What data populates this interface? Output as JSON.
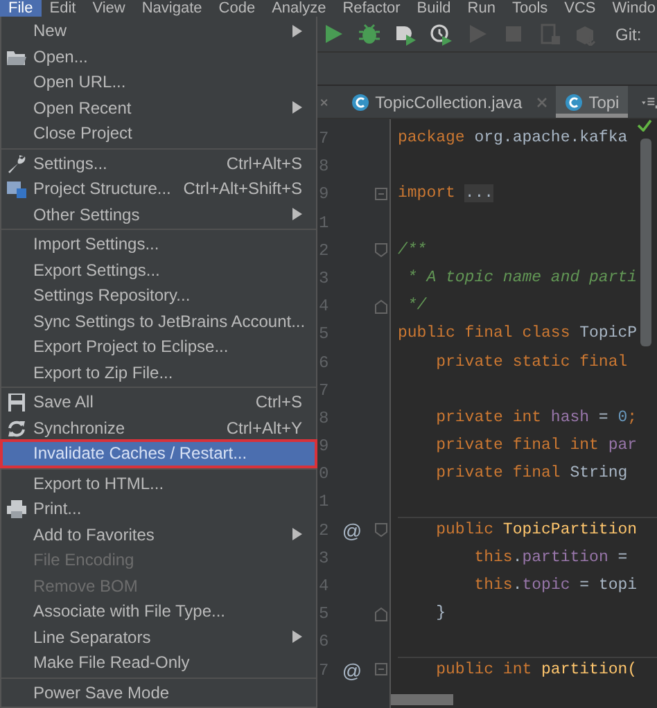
{
  "menubar": [
    {
      "label": "File",
      "selected": true
    },
    {
      "label": "Edit",
      "selected": false
    },
    {
      "label": "View",
      "selected": false
    },
    {
      "label": "Navigate",
      "selected": false
    },
    {
      "label": "Code",
      "selected": false
    },
    {
      "label": "Analyze",
      "selected": false
    },
    {
      "label": "Refactor",
      "selected": false
    },
    {
      "label": "Build",
      "selected": false
    },
    {
      "label": "Run",
      "selected": false
    },
    {
      "label": "Tools",
      "selected": false
    },
    {
      "label": "VCS",
      "selected": false
    },
    {
      "label": "Windo",
      "selected": false
    }
  ],
  "toolbar": {
    "buttons": [
      {
        "kind": "run",
        "disabled": false
      },
      {
        "kind": "debug",
        "disabled": false
      },
      {
        "kind": "coverage",
        "disabled": false
      },
      {
        "kind": "profile",
        "disabled": false
      },
      {
        "kind": "run",
        "disabled": true
      },
      {
        "kind": "stop",
        "disabled": true
      },
      {
        "kind": "device",
        "disabled": true
      },
      {
        "kind": "sdk",
        "disabled": true
      }
    ],
    "vcs_label": "Git:"
  },
  "tabs": [
    {
      "label": "TopicCollection.java",
      "selected": false
    },
    {
      "label": "Topi",
      "selected": true
    }
  ],
  "menu": {
    "groups": [
      {
        "items": [
          {
            "label": "New",
            "kind": "text",
            "submenu": true,
            "disabled": false,
            "selected": false
          },
          {
            "label": "Open...",
            "kind": "folder",
            "submenu": false,
            "disabled": false,
            "selected": false
          },
          {
            "label": "Open URL...",
            "kind": "text",
            "submenu": false,
            "disabled": false,
            "selected": false
          },
          {
            "label": "Open Recent",
            "kind": "text",
            "submenu": true,
            "disabled": false,
            "selected": false
          },
          {
            "label": "Close Project",
            "kind": "text",
            "submenu": false,
            "disabled": false,
            "selected": false
          }
        ]
      },
      {
        "items": [
          {
            "label": "Settings...",
            "shortcut": "Ctrl+Alt+S",
            "kind": "wrench",
            "submenu": false,
            "disabled": false,
            "selected": false
          },
          {
            "label": "Project Structure...",
            "shortcut": "Ctrl+Alt+Shift+S",
            "kind": "structure",
            "submenu": false,
            "disabled": false,
            "selected": false
          },
          {
            "label": "Other Settings",
            "kind": "text",
            "submenu": true,
            "disabled": false,
            "selected": false
          }
        ]
      },
      {
        "items": [
          {
            "label": "Import Settings...",
            "kind": "text",
            "submenu": false,
            "disabled": false,
            "selected": false
          },
          {
            "label": "Export Settings...",
            "kind": "text",
            "submenu": false,
            "disabled": false,
            "selected": false
          },
          {
            "label": "Settings Repository...",
            "kind": "text",
            "submenu": false,
            "disabled": false,
            "selected": false
          },
          {
            "label": "Sync Settings to JetBrains Account...",
            "kind": "text",
            "submenu": false,
            "disabled": false,
            "selected": false
          },
          {
            "label": "Export Project to Eclipse...",
            "kind": "text",
            "submenu": false,
            "disabled": false,
            "selected": false
          },
          {
            "label": "Export to Zip File...",
            "kind": "text",
            "submenu": false,
            "disabled": false,
            "selected": false
          }
        ]
      },
      {
        "items": [
          {
            "label": "Save All",
            "shortcut": "Ctrl+S",
            "kind": "save",
            "submenu": false,
            "disabled": false,
            "selected": false
          },
          {
            "label": "Synchronize",
            "shortcut": "Ctrl+Alt+Y",
            "kind": "sync",
            "submenu": false,
            "disabled": false,
            "selected": false
          },
          {
            "label": "Invalidate Caches / Restart...",
            "kind": "text",
            "submenu": false,
            "disabled": false,
            "selected": true
          }
        ]
      },
      {
        "items": [
          {
            "label": "Export to HTML...",
            "kind": "text",
            "submenu": false,
            "disabled": false,
            "selected": false
          },
          {
            "label": "Print...",
            "kind": "print",
            "submenu": false,
            "disabled": false,
            "selected": false
          },
          {
            "label": "Add to Favorites",
            "kind": "text",
            "submenu": true,
            "disabled": false,
            "selected": false
          },
          {
            "label": "File Encoding",
            "kind": "text",
            "submenu": false,
            "disabled": true,
            "selected": false
          },
          {
            "label": "Remove BOM",
            "kind": "text",
            "submenu": false,
            "disabled": true,
            "selected": false
          },
          {
            "label": "Associate with File Type...",
            "kind": "text",
            "submenu": false,
            "disabled": false,
            "selected": false
          },
          {
            "label": "Line Separators",
            "kind": "text",
            "submenu": true,
            "disabled": false,
            "selected": false
          },
          {
            "label": "Make File Read-Only",
            "kind": "text",
            "submenu": false,
            "disabled": false,
            "selected": false
          }
        ]
      },
      {
        "items": [
          {
            "label": "Power Save Mode",
            "kind": "text",
            "submenu": false,
            "disabled": false,
            "selected": false
          }
        ]
      }
    ]
  },
  "editor": {
    "lines": [
      {
        "number": "7",
        "tokens": [
          {
            "t": "package ",
            "kind": "kw"
          },
          {
            "t": "org.apache.kafka",
            "kind": "plain"
          }
        ]
      },
      {
        "number": "8"
      },
      {
        "number": "9",
        "fold": {
          "kind": "plus"
        },
        "tokens": [
          {
            "t": "import ",
            "kind": "kw"
          },
          {
            "t": "...",
            "kind": "folded"
          }
        ]
      },
      {
        "number": "1"
      },
      {
        "number": "2",
        "fold": {
          "kind": "open"
        },
        "tokens": [
          {
            "t": "/**",
            "kind": "doc"
          }
        ]
      },
      {
        "number": "3",
        "tokens": [
          {
            "t": " * A topic name and parti",
            "kind": "doc"
          }
        ]
      },
      {
        "number": "4",
        "fold": {
          "kind": "close"
        },
        "tokens": [
          {
            "t": " */",
            "kind": "doc"
          }
        ]
      },
      {
        "number": "5",
        "tokens": [
          {
            "t": "public final class ",
            "kind": "kw"
          },
          {
            "t": "TopicP",
            "kind": "plain"
          }
        ]
      },
      {
        "number": "6",
        "tokens": [
          {
            "t": "    private static final",
            "kind": "kw"
          }
        ]
      },
      {
        "number": "7"
      },
      {
        "number": "8",
        "tokens": [
          {
            "t": "    private int ",
            "kind": "kw"
          },
          {
            "t": "hash",
            "kind": "field"
          },
          {
            "t": " = ",
            "kind": "plain"
          },
          {
            "t": "0",
            "kind": "num"
          },
          {
            "t": ";",
            "kind": "kw"
          }
        ]
      },
      {
        "number": "9",
        "tokens": [
          {
            "t": "    private final int ",
            "kind": "kw"
          },
          {
            "t": "par",
            "kind": "field"
          }
        ]
      },
      {
        "number": "0",
        "tokens": [
          {
            "t": "    private final ",
            "kind": "kw"
          },
          {
            "t": "String",
            "kind": "plain"
          }
        ]
      },
      {
        "number": "1"
      },
      {
        "number": "2",
        "marker": "@",
        "fold": {
          "kind": "open"
        },
        "tokens": [
          {
            "t": "    public ",
            "kind": "kw"
          },
          {
            "t": "TopicPartition",
            "kind": "method"
          }
        ]
      },
      {
        "number": "3",
        "tokens": [
          {
            "t": "        this",
            "kind": "kw"
          },
          {
            "t": ".",
            "kind": "plain"
          },
          {
            "t": "partition",
            "kind": "field"
          },
          {
            "t": " =",
            "kind": "plain"
          }
        ]
      },
      {
        "number": "4",
        "tokens": [
          {
            "t": "        this",
            "kind": "kw"
          },
          {
            "t": ".",
            "kind": "plain"
          },
          {
            "t": "topic",
            "kind": "field"
          },
          {
            "t": " = topi",
            "kind": "plain"
          }
        ]
      },
      {
        "number": "5",
        "fold": {
          "kind": "close"
        },
        "tokens": [
          {
            "t": "    }",
            "kind": "plain"
          }
        ]
      },
      {
        "number": "6"
      },
      {
        "number": "7",
        "marker": "@",
        "fold": {
          "kind": "plus"
        },
        "tokens": [
          {
            "t": "    public int ",
            "kind": "kw"
          },
          {
            "t": "partition(",
            "kind": "method"
          }
        ]
      }
    ]
  }
}
